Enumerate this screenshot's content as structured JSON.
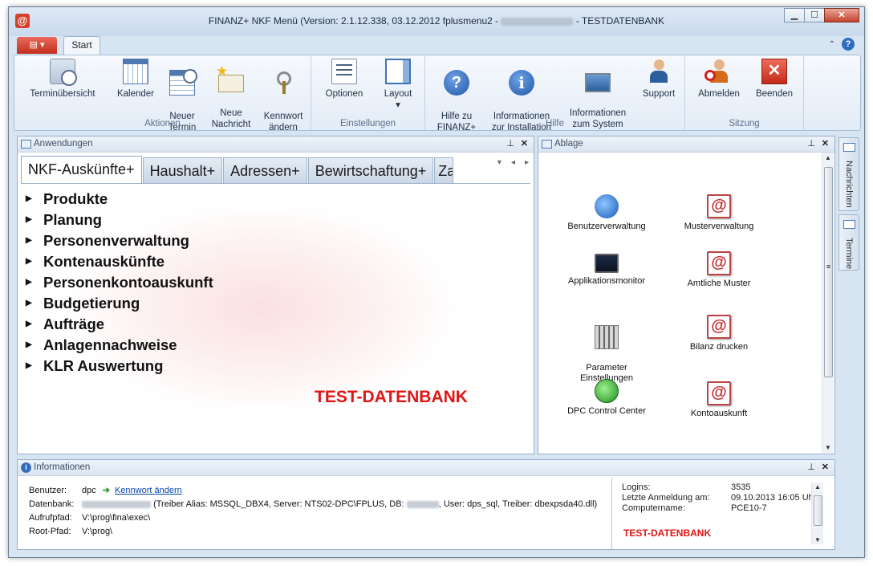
{
  "window": {
    "title_left": "FINANZ+ NKF Menü (Version: 2.1.12.338, 03.12.2012 fplusmenu2 -",
    "title_right": "- TESTDATENBANK",
    "app_icon": "@",
    "controls": {
      "minimize": "▁",
      "maximize": "☐",
      "close": "✕"
    }
  },
  "ribbon": {
    "menu_button": "▤ ▾",
    "tab": "Start",
    "collapse_icon": "⌃",
    "help_icon": "?",
    "groups": [
      {
        "label": "Aktionen",
        "buttons": [
          "Terminübersicht",
          "Kalender",
          "Neuer\nTermin",
          "Neue\nNachricht",
          "Kennwort\nändern"
        ]
      },
      {
        "label": "Einstellungen",
        "buttons": [
          "Optionen",
          "Layout"
        ]
      },
      {
        "label": "Hilfe",
        "buttons": [
          "Hilfe zu\nFINANZ+",
          "Informationen\nzur Installation",
          "Informationen\nzum System",
          "Support"
        ]
      },
      {
        "label": "Sitzung",
        "buttons": [
          "Abmelden",
          "Beenden"
        ]
      }
    ],
    "layout_dropdown": "▾"
  },
  "anwendungen": {
    "title": "Anwendungen",
    "pin": "⊥",
    "close": "✕",
    "tabs": [
      "NKF-Auskünfte+",
      "Haushalt+",
      "Adressen+",
      "Bewirtschaftung+",
      "Za"
    ],
    "tab_nav": [
      "▾",
      "◂",
      "▸"
    ],
    "tree": [
      "Produkte",
      "Planung",
      "Personenverwaltung",
      "Kontenauskünfte",
      "Personenkontoauskunft",
      "Budgetierung",
      "Aufträge",
      "Anlagennachweise",
      "KLR Auswertung"
    ],
    "expander": "▶",
    "banner": "TEST-DATENBANK"
  },
  "ablage": {
    "title": "Ablage",
    "pin": "⊥",
    "close": "✕",
    "items": [
      "Benutzerverwaltung",
      "Musterverwaltung",
      "Applikationsmonitor",
      "Amtliche Muster",
      "Parameter\nEinstellungen",
      "Bilanz drucken",
      "DPC Control Center",
      "Kontoauskunft"
    ],
    "at_glyph": "@",
    "scroll_up": "▲",
    "scroll_down": "▼",
    "grip": "≡"
  },
  "side_tabs": [
    "Nachrichten",
    "Termine"
  ],
  "informationen": {
    "title": "Informationen",
    "pin": "⊥",
    "close": "✕",
    "icon": "i",
    "rows": {
      "benutzer_label": "Benutzer:",
      "benutzer_value": "dpc",
      "change_password_arrow": "➔",
      "change_password": "Kennwort ändern",
      "datenbank_label": "Datenbank:",
      "datenbank_value_a": "(Treiber Alias: MSSQL_DBX4, Server: NTS02-DPC\\FPLUS, DB:",
      "datenbank_value_b": ", User: dps_sql, Treiber: dbexpsda40.dll)",
      "aufrufpfad_label": "Aufrufpfad:",
      "aufrufpfad_value": "V:\\prog\\fina\\exec\\",
      "rootpfad_label": "Root-Pfad:",
      "rootpfad_value": "V:\\prog\\"
    },
    "stats": {
      "logins_label": "Logins:",
      "logins_value": "3535",
      "last_login_label": "Letzte Anmeldung am:",
      "last_login_value": "09.10.2013 16:05 Uhr",
      "computer_label": "Computername:",
      "computer_value": "PCE10-7",
      "banner": "TEST-DATENBANK"
    }
  }
}
